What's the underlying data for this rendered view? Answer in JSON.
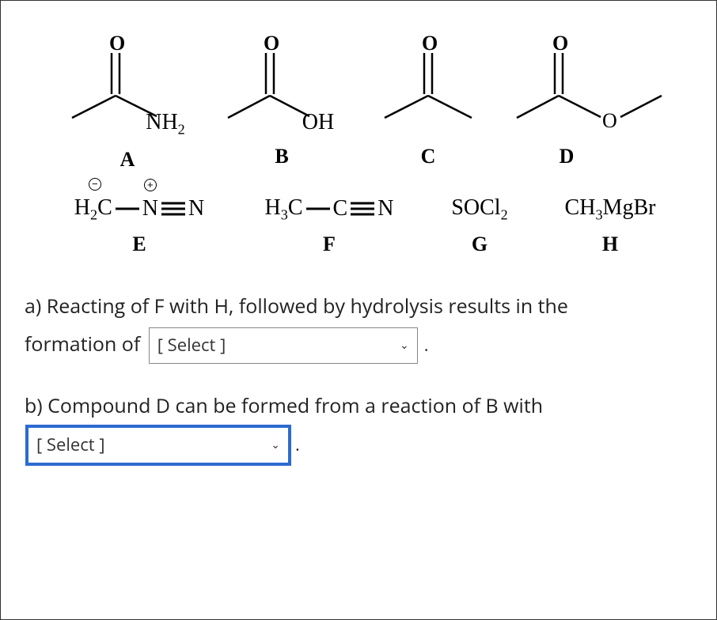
{
  "compounds": {
    "A": {
      "label": "A",
      "text_right": "NH2"
    },
    "B": {
      "label": "B",
      "text_right": "OH"
    },
    "C": {
      "label": "C"
    },
    "D": {
      "label": "D"
    },
    "E": {
      "label": "E",
      "formula_left": "H2C",
      "formula_mid": "N",
      "formula_right": "N",
      "charge_left": "−",
      "charge_right": "+"
    },
    "F": {
      "label": "F",
      "formula_left": "H3C",
      "formula_mid": "C",
      "formula_right": "N"
    },
    "G": {
      "label": "G",
      "formula": "SOCl2"
    },
    "H": {
      "label": "H",
      "formula": "CH3MgBr"
    }
  },
  "questions": {
    "a": {
      "text_before": "a) Reacting of F with H, followed by hydrolysis results in the",
      "text_line2": "formation of",
      "select_placeholder": "[ Select ]",
      "period": "."
    },
    "b": {
      "text_before": "b) Compound D can be formed from a reaction of B with",
      "select_placeholder": "[ Select ]",
      "period": "."
    }
  }
}
